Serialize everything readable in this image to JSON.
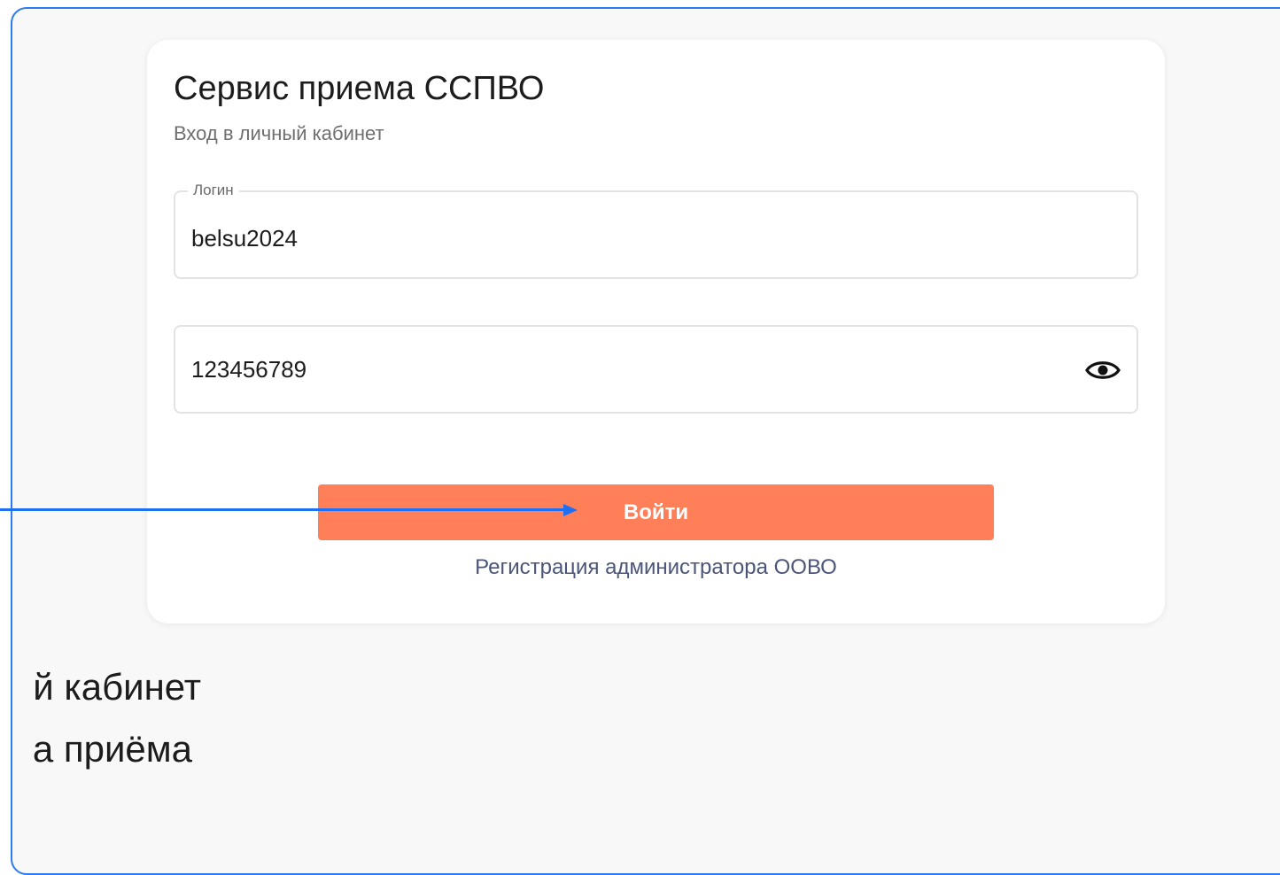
{
  "card": {
    "title": "Сервис приема ССПВО",
    "subtitle": "Вход в личный кабинет"
  },
  "login_field": {
    "label": "Логин",
    "value": "belsu2024"
  },
  "password_field": {
    "value": "123456789",
    "toggle_icon": "eye-icon"
  },
  "actions": {
    "login_button": "Войти",
    "register_link": "Регистрация администратора ООВО"
  },
  "caption": {
    "line1": "й кабинет",
    "line2": "а приёма"
  },
  "colors": {
    "accent": "#ff7f59",
    "frame_border": "#2b7bf3",
    "pointer": "#1f6ff2",
    "link": "#4a5578"
  }
}
